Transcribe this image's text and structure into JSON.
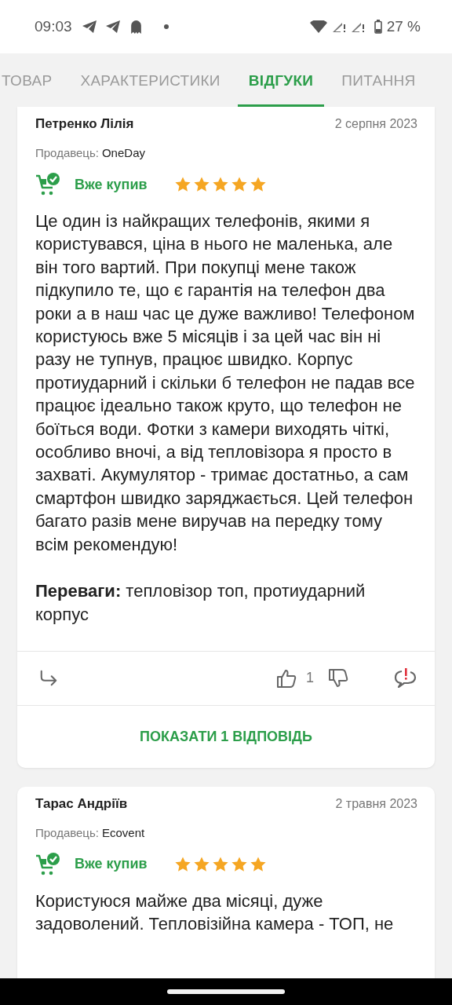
{
  "status_bar": {
    "time": "09:03",
    "battery": "27 %"
  },
  "tabs": [
    {
      "label": "ТОВАР",
      "selected": false
    },
    {
      "label": "ХАРАКТЕРИСТИКИ",
      "selected": false
    },
    {
      "label": "ВІДГУКИ",
      "selected": true
    },
    {
      "label": "ПИТАННЯ",
      "selected": false
    }
  ],
  "reviews": [
    {
      "author": "Петренко Лілія",
      "date": "2 серпня 2023",
      "seller_label": "Продавець:",
      "seller": "OneDay",
      "purchased": "Вже купив",
      "stars": 5,
      "text": "Це один із найкращих телефонів, якими я користувався, ціна в нього не маленька, але він того вартий. При покупці мене також підкупило те, що є гарантія на телефон два роки а в наш час це дуже важливо! Телефоном користуюсь вже 5 місяців і за цей час він ні разу не тупнув, працює швидко. Корпус протиударний і скільки б телефон не падав все працює ідеально також круто, що телефон не боїться води. Фотки з камери виходять чіткі, особливо вночі, а від тепловізора я просто в захваті. Акумулятор - тримає достатньо, а сам смартфон швидко заряджається. Цей телефон багато разів мене виручав на передку тому всім рекомендую!",
      "pros": "**Переваги:** тепловізор топ, протиударний корпус",
      "likes": "1",
      "replies_button": "ПОКАЗАТИ 1 ВІДПОВІДЬ"
    },
    {
      "author": "Тарас Андріїв",
      "date": "2 травня 2023",
      "seller_label": "Продавець:",
      "seller": "Ecovent",
      "purchased": "Вже купив",
      "stars": 5,
      "text": "Користуюся майже два місяці, дуже задоволений. Тепловізійна камера - ТОП, не"
    }
  ]
}
